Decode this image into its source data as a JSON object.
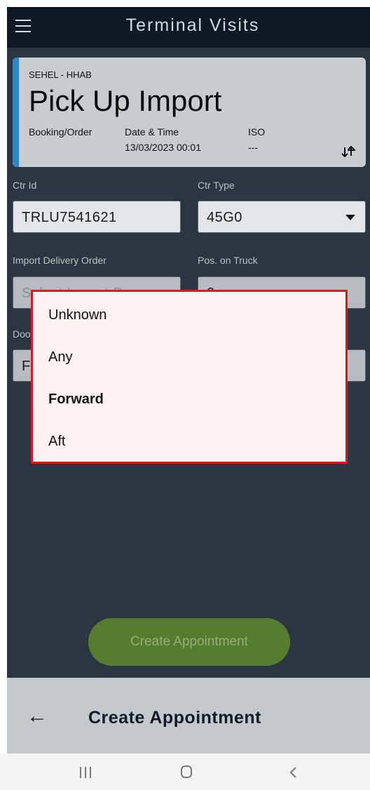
{
  "app_bar": {
    "title": "Terminal Visits",
    "menu_icon": "hamburger-menu-icon"
  },
  "card": {
    "accent_color": "#2f86c7",
    "subtitle": "SEHEL - HHAB",
    "title": "Pick Up Import",
    "booking_label": "Booking/Order",
    "datetime_label": "Date & Time",
    "datetime_value": "13/03/2023 00:01",
    "iso_label": "ISO",
    "iso_value": "---",
    "icon": "swap-vertical-icon"
  },
  "form": {
    "ctr_id_label": "Ctr Id",
    "ctr_id_value": "TRLU7541621",
    "ctr_type_label": "Ctr Type",
    "ctr_type_value": "45G0",
    "import_do_label": "Import Delivery Order",
    "import_do_placeholder": "Select Import D",
    "pos_truck_label": "Pos. on Truck",
    "pos_truck_value": "2",
    "door_label": "Doo",
    "door_value": "F"
  },
  "popup": {
    "border_color": "#e0152a",
    "options": [
      "Unknown",
      "Any",
      "Forward",
      "Aft"
    ],
    "selected": "Forward"
  },
  "create_button": {
    "label": "Create Appointment",
    "color": "#567d2f"
  },
  "bottom_bar": {
    "title": "Create Appointment",
    "back_icon": "back-arrow-icon"
  },
  "nav_bar": {
    "icons": [
      "recent-apps-icon",
      "home-icon",
      "back-icon"
    ]
  }
}
